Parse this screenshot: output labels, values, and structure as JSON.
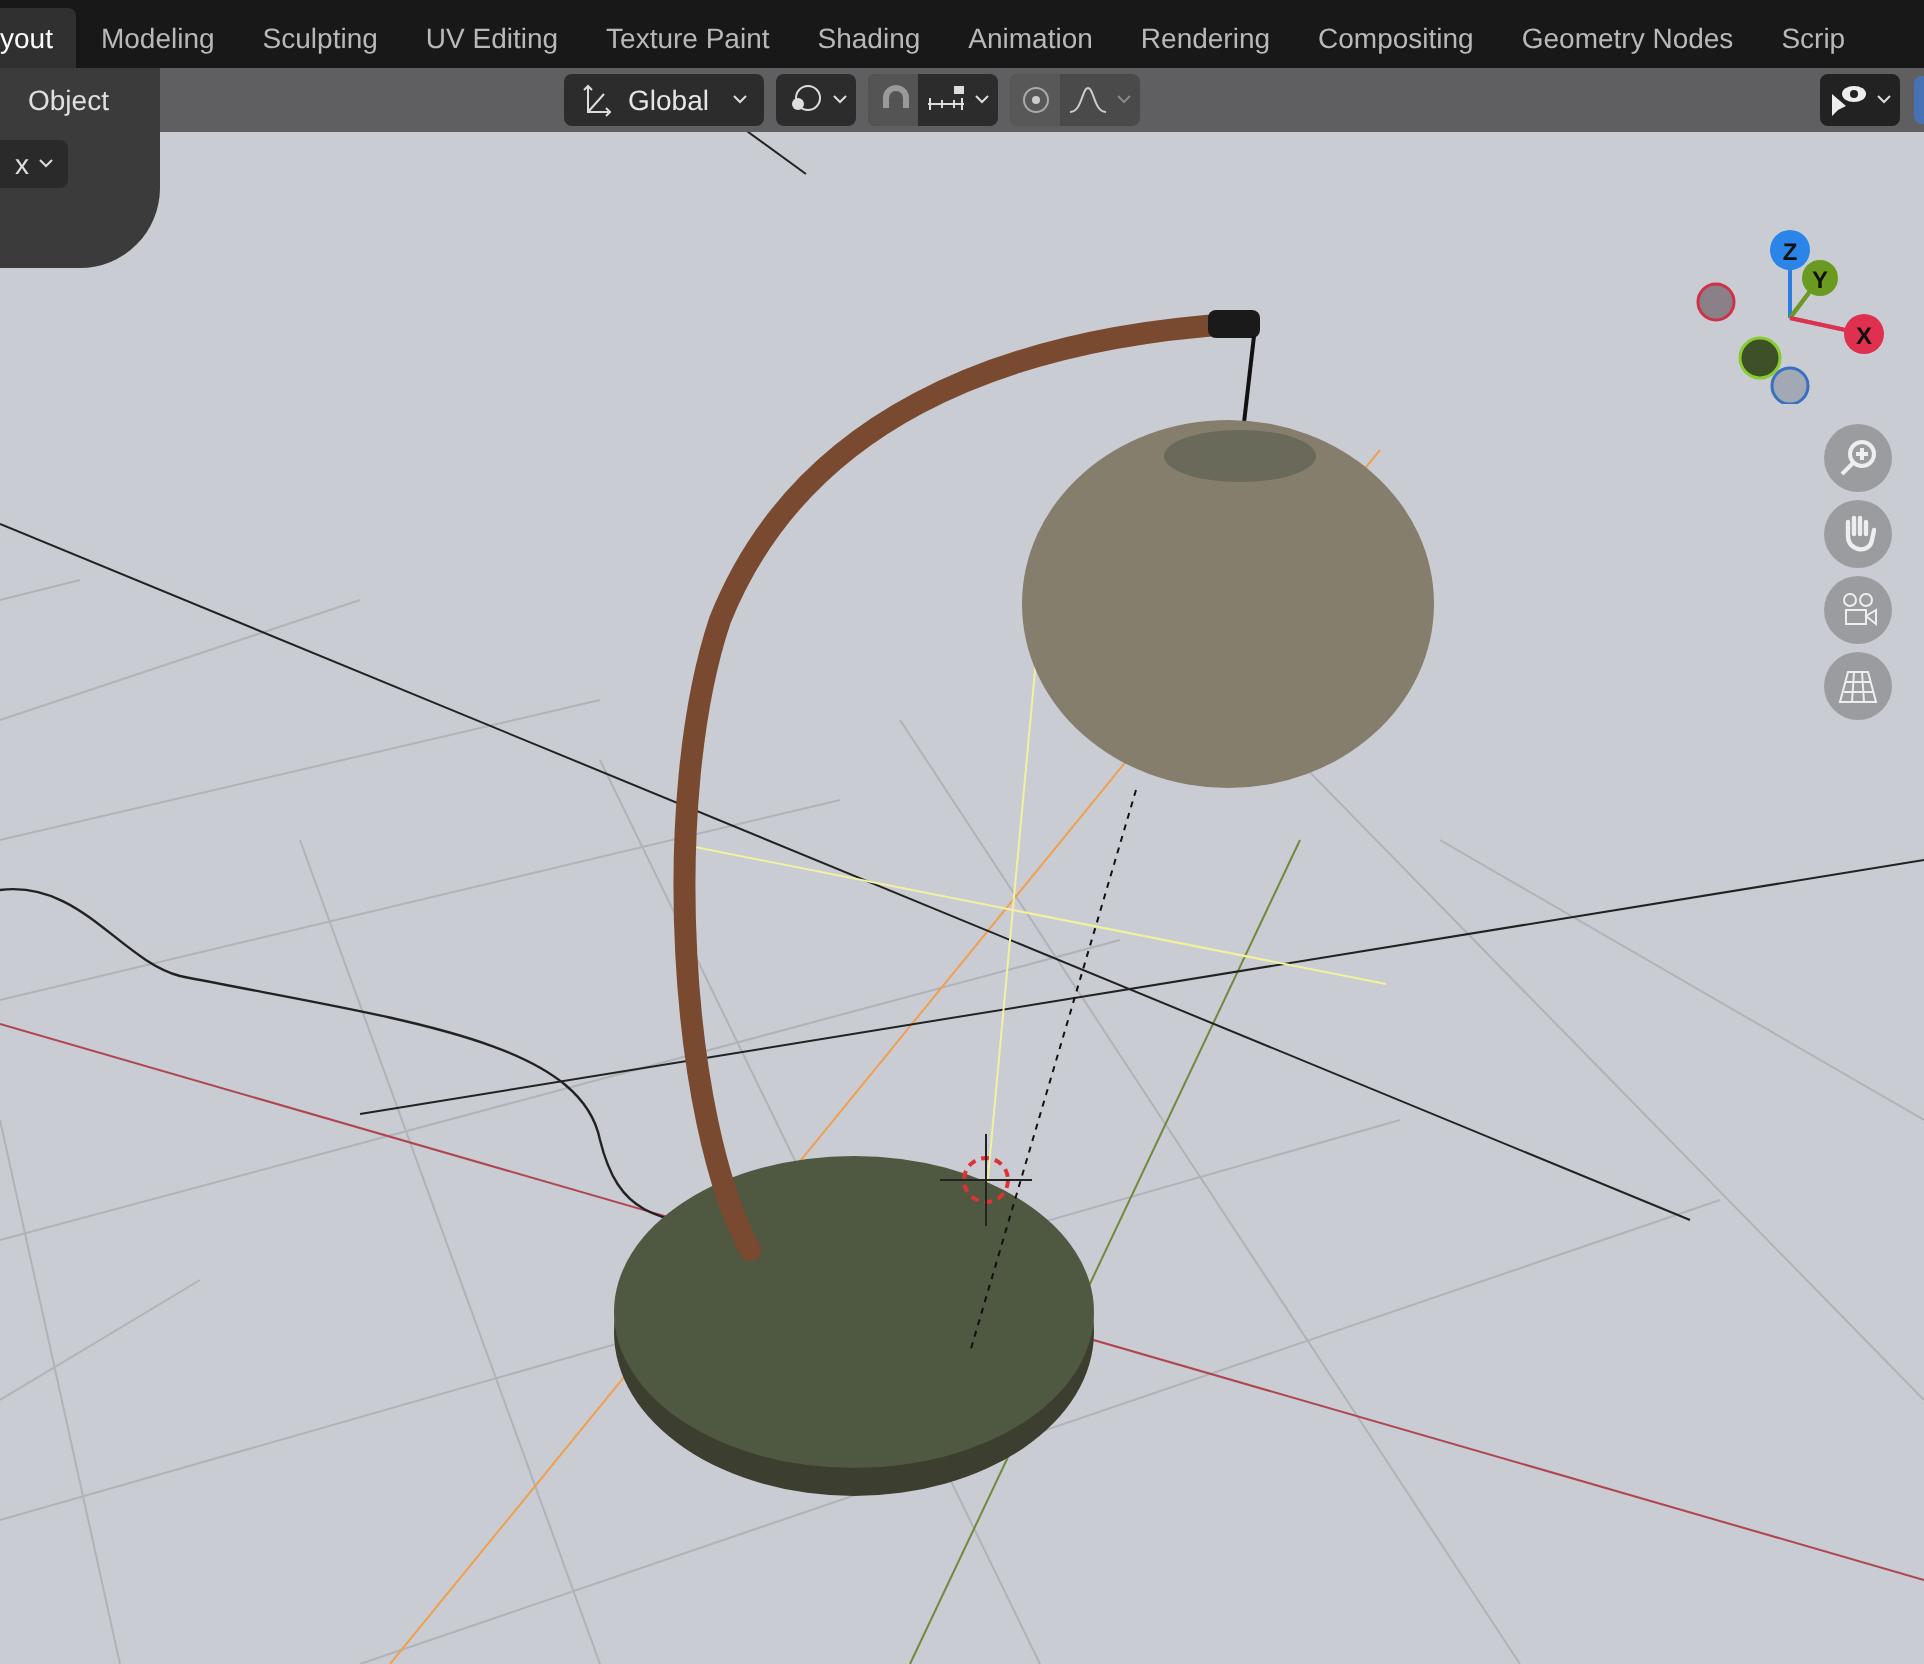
{
  "workspace_tabs": [
    {
      "label": "yout",
      "selected": true
    },
    {
      "label": "Modeling",
      "selected": false
    },
    {
      "label": "Sculpting",
      "selected": false
    },
    {
      "label": "UV Editing",
      "selected": false
    },
    {
      "label": "Texture Paint",
      "selected": false
    },
    {
      "label": "Shading",
      "selected": false
    },
    {
      "label": "Animation",
      "selected": false
    },
    {
      "label": "Rendering",
      "selected": false
    },
    {
      "label": "Compositing",
      "selected": false
    },
    {
      "label": "Geometry Nodes",
      "selected": false
    },
    {
      "label": "Scrip",
      "selected": false
    }
  ],
  "header": {
    "mode": "Object",
    "orientation": "Global",
    "proportional_editing": false,
    "snapping": false
  },
  "viewport": {
    "dropdown": "x",
    "gizmo": {
      "axes": [
        "Z",
        "Y",
        "X"
      ]
    }
  }
}
